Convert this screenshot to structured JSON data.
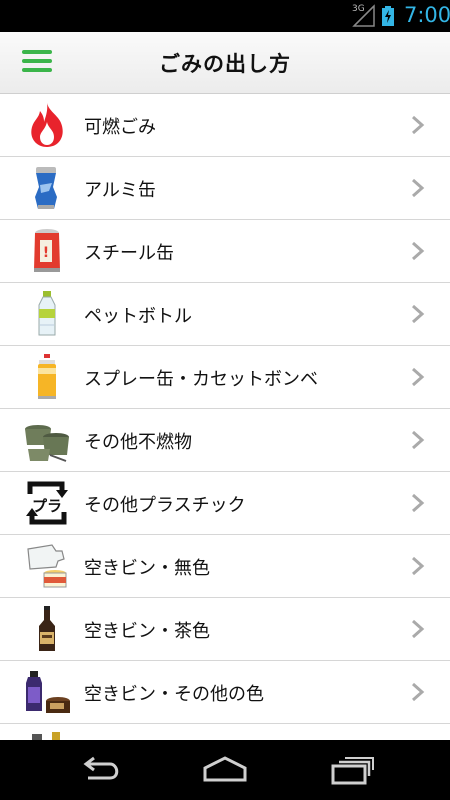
{
  "status_bar": {
    "network": "3G",
    "time": "7:00"
  },
  "header": {
    "title": "ごみの出し方",
    "accent_color": "#3bb54a"
  },
  "items": [
    {
      "label": "可燃ごみ",
      "icon": "flame-icon"
    },
    {
      "label": "アルミ缶",
      "icon": "aluminum-can-icon"
    },
    {
      "label": "スチール缶",
      "icon": "steel-can-icon"
    },
    {
      "label": "ペットボトル",
      "icon": "pet-bottle-icon"
    },
    {
      "label": "スプレー缶・カセットボンベ",
      "icon": "spray-can-icon"
    },
    {
      "label": "その他不燃物",
      "icon": "pots-icon"
    },
    {
      "label": "その他プラスチック",
      "icon": "plastic-recycle-mark-icon"
    },
    {
      "label": "空きビン・無色",
      "icon": "clear-bottle-icon"
    },
    {
      "label": "空きビン・茶色",
      "icon": "brown-bottle-icon"
    },
    {
      "label": "空きビン・その他の色",
      "icon": "colored-bottle-icon"
    }
  ],
  "nav_bar": {
    "buttons": [
      "back-icon",
      "home-icon",
      "recent-apps-icon"
    ]
  }
}
